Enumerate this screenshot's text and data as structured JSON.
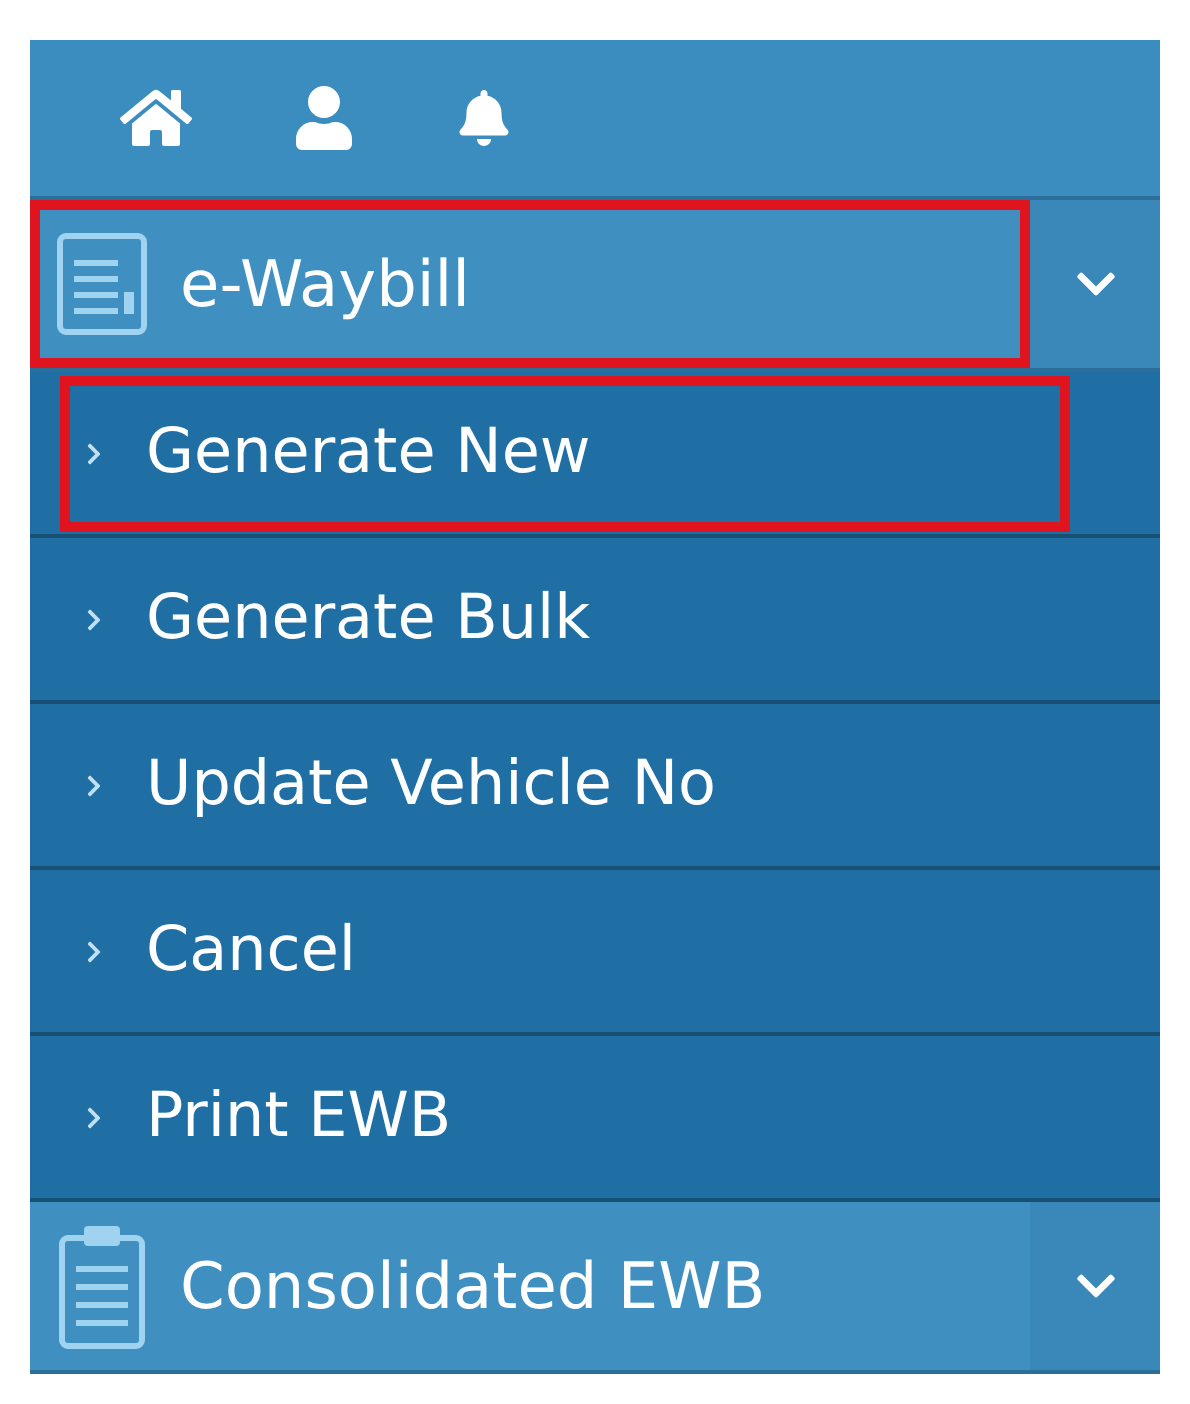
{
  "top_icons": [
    {
      "kind": "home"
    },
    {
      "kind": "user"
    },
    {
      "kind": "bell"
    }
  ],
  "menu": [
    {
      "label": "e-Waybill",
      "kind": "document",
      "expanded": true,
      "highlighted": true,
      "children": [
        {
          "label": "Generate New",
          "highlighted": true
        },
        {
          "label": "Generate Bulk",
          "highlighted": false
        },
        {
          "label": "Update Vehicle No",
          "highlighted": false
        },
        {
          "label": "Cancel",
          "highlighted": false
        },
        {
          "label": "Print EWB",
          "highlighted": false
        }
      ]
    },
    {
      "label": "Consolidated EWB",
      "kind": "clipboard",
      "expanded": false,
      "highlighted": false
    }
  ]
}
